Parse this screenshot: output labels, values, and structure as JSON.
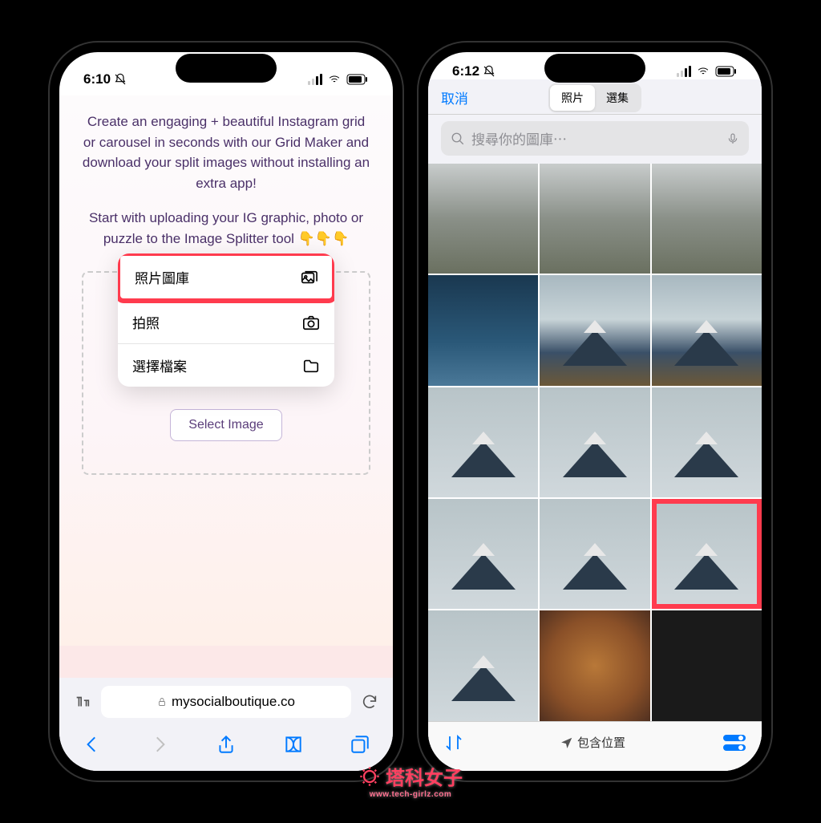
{
  "phone1": {
    "status": {
      "time": "6:10"
    },
    "intro1": "Create an engaging + beautiful Instagram grid or carousel in seconds with our Grid Maker and download your split images without installing an extra app!",
    "intro2": "Start with uploading your IG graphic, photo or puzzle to the Image Splitter tool 👇👇👇",
    "menu": {
      "photo_library": "照片圖庫",
      "take_photo": "拍照",
      "choose_file": "選擇檔案"
    },
    "select_button": "Select Image",
    "url": "mysocialboutique.co"
  },
  "phone2": {
    "status": {
      "time": "6:12"
    },
    "cancel": "取消",
    "segment": {
      "photos": "照片",
      "albums": "選集"
    },
    "search_placeholder": "搜尋你的圖庫⋯",
    "footer_label": "包含位置"
  },
  "watermark": {
    "title": "塔科女子",
    "url": "www.tech-girlz.com"
  }
}
